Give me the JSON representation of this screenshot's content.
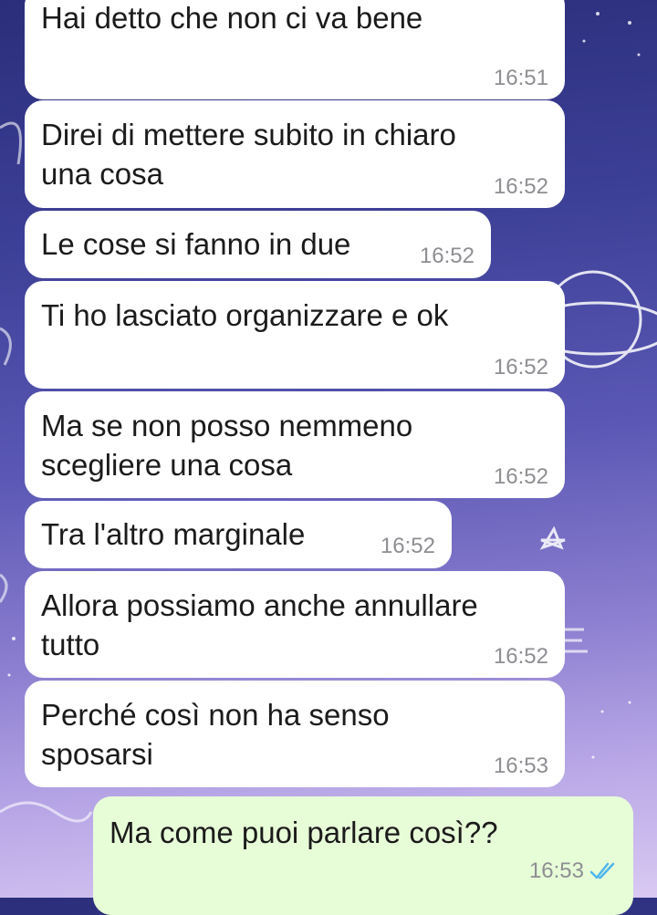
{
  "messages": [
    {
      "text": "Hai detto che non ci va bene",
      "time": "16:51"
    },
    {
      "text": "Direi di mettere subito in chiaro\nuna cosa",
      "time": "16:52"
    },
    {
      "text": "Le cose si fanno in due",
      "time": "16:52"
    },
    {
      "text": "Ti ho lasciato organizzare e ok",
      "time": "16:52"
    },
    {
      "text": "Ma se non posso nemmeno\nscegliere una cosa",
      "time": "16:52"
    },
    {
      "text": "Tra l'altro marginale",
      "time": "16:52"
    },
    {
      "text": "Allora possiamo anche annullare\ntutto",
      "time": "16:52"
    },
    {
      "text": "Perché così non ha senso\nsposarsi",
      "time": "16:53"
    },
    {
      "text": "Ma come puoi parlare così??",
      "time": "16:53",
      "status": "read",
      "status_icon": "double-check-icon"
    }
  ],
  "colors": {
    "incoming_bubble": "#ffffff",
    "outgoing_bubble": "#e7fdd8",
    "time_text": "#8e8e93",
    "read_check": "#4fb6ec"
  }
}
